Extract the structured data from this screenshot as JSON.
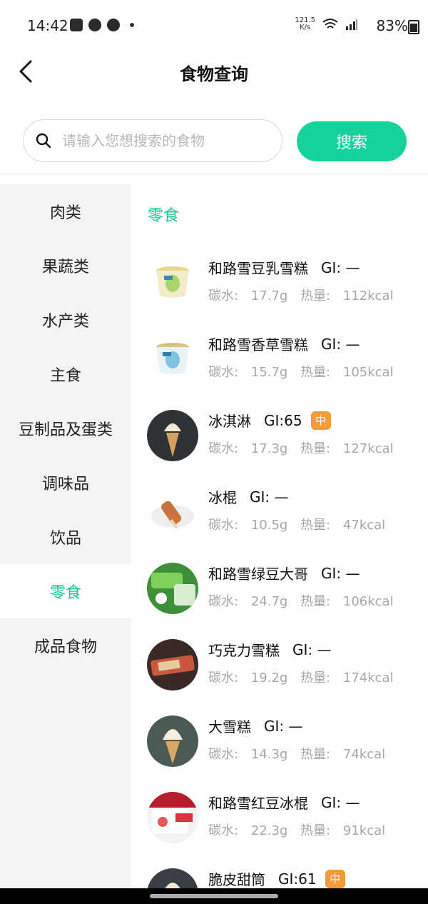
{
  "status_bar": {
    "time": "14:42",
    "speed_value": "121.5",
    "speed_unit": "K/s",
    "battery": "83%"
  },
  "header": {
    "title": "食物查询"
  },
  "search": {
    "placeholder": "请输入您想搜索的食物",
    "value": "",
    "button_label": "搜索"
  },
  "sidebar": {
    "items": [
      {
        "label": "肉类",
        "active": false
      },
      {
        "label": "果蔬类",
        "active": false
      },
      {
        "label": "水产类",
        "active": false
      },
      {
        "label": "主食",
        "active": false
      },
      {
        "label": "豆制品及蛋类",
        "active": false
      },
      {
        "label": "调味品",
        "active": false
      },
      {
        "label": "饮品",
        "active": false
      },
      {
        "label": "零食",
        "active": true
      },
      {
        "label": "成品食物",
        "active": false
      }
    ]
  },
  "main": {
    "category_title": "零食",
    "carb_label": "碳水:",
    "energy_label": "热量:",
    "foods": [
      {
        "name": "和路雪豆乳雪糕",
        "gi": "GI: —",
        "carb": "17.7g",
        "energy": "112kcal",
        "badge": ""
      },
      {
        "name": "和路雪香草雪糕",
        "gi": "GI: —",
        "carb": "15.7g",
        "energy": "105kcal",
        "badge": ""
      },
      {
        "name": "冰淇淋",
        "gi": "GI:65",
        "carb": "17.3g",
        "energy": "127kcal",
        "badge": "中"
      },
      {
        "name": "冰棍",
        "gi": "GI: —",
        "carb": "10.5g",
        "energy": "47kcal",
        "badge": ""
      },
      {
        "name": "和路雪绿豆大哥",
        "gi": "GI: —",
        "carb": "24.7g",
        "energy": "106kcal",
        "badge": ""
      },
      {
        "name": "巧克力雪糕",
        "gi": "GI: —",
        "carb": "19.2g",
        "energy": "174kcal",
        "badge": ""
      },
      {
        "name": "大雪糕",
        "gi": "GI: —",
        "carb": "14.3g",
        "energy": "74kcal",
        "badge": ""
      },
      {
        "name": "和路雪红豆冰棍",
        "gi": "GI: —",
        "carb": "22.3g",
        "energy": "91kcal",
        "badge": ""
      },
      {
        "name": "脆皮甜筒",
        "gi": "GI:61",
        "carb": "",
        "energy": "",
        "badge": "中"
      }
    ]
  },
  "colors": {
    "accent": "#15d39b",
    "badge_medium": "#f39a3b",
    "sidebar_bg": "#f4f4f4"
  }
}
